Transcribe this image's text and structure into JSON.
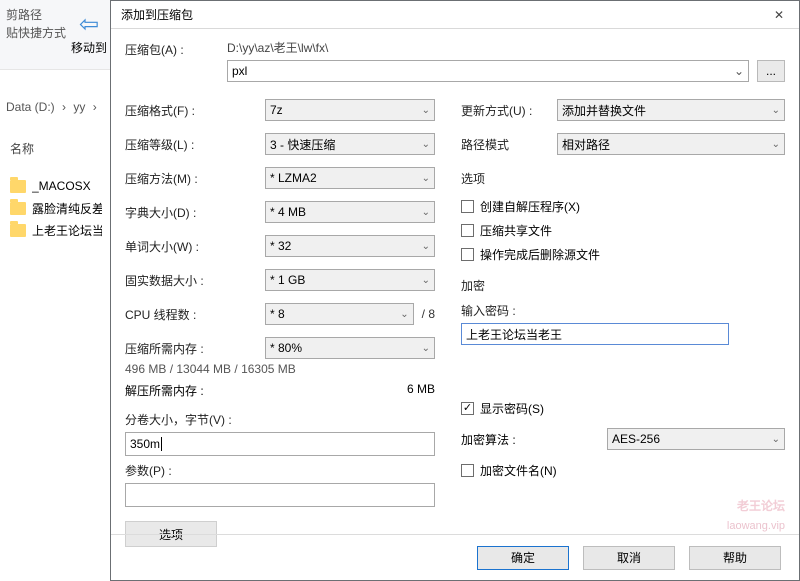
{
  "explorer": {
    "cut1": "剪路径",
    "cut2": "贴快捷方式",
    "moveTo": "移动到",
    "breadcrumb": {
      "drive": "Data (D:)",
      "sep1": "›",
      "folder": "yy",
      "sep2": "›"
    },
    "colName": "名称",
    "folders": [
      "_MACOSX",
      "露脸清纯反差",
      "上老王论坛当"
    ]
  },
  "dialog": {
    "title": "添加到压缩包",
    "archiveLabel": "压缩包(A) :",
    "archivePath": "D:\\yy\\az\\老王\\lw\\fx\\",
    "archiveName": "pxl",
    "browse": "...",
    "left": {
      "formatLabel": "压缩格式(F) :",
      "formatValue": "7z",
      "levelLabel": "压缩等级(L) :",
      "levelValue": "3 - 快速压缩",
      "methodLabel": "压缩方法(M) :",
      "methodValue": "* LZMA2",
      "dictLabel": "字典大小(D) :",
      "dictValue": "* 4 MB",
      "wordLabel": "单词大小(W) :",
      "wordValue": "* 32",
      "solidLabel": "固实数据大小 :",
      "solidValue": "* 1 GB",
      "cpuLabel": "CPU 线程数 :",
      "cpuValue": "* 8",
      "cpuTail": "/ 8",
      "memCompLabel": "压缩所需内存 :",
      "memPct": "* 80%",
      "memCompValue": "496 MB / 13044 MB / 16305 MB",
      "memDecompLabel": "解压所需内存 :",
      "memDecompValue": "6 MB",
      "splitLabel": "分卷大小，字节(V) :",
      "splitValue": "350m",
      "paramLabel": "参数(P) :",
      "paramValue": "",
      "optionsBtn": "选项"
    },
    "right": {
      "updateLabel": "更新方式(U) :",
      "updateValue": "添加并替换文件",
      "pathLabel": "路径模式",
      "pathValue": "相对路径",
      "optionsHead": "选项",
      "chk1": "创建自解压程序(X)",
      "chk2": "压缩共享文件",
      "chk3": "操作完成后删除源文件",
      "encHead": "加密",
      "pwLabel": "输入密码 :",
      "pwValue": "上老王论坛当老王",
      "showPw": "显示密码(S)",
      "algLabel": "加密算法 :",
      "algValue": "AES-256",
      "encNames": "加密文件名(N)"
    },
    "buttons": {
      "ok": "确定",
      "cancel": "取消",
      "help": "帮助"
    }
  },
  "watermark": {
    "main": "老王论坛",
    "sub": "laowang.vip"
  }
}
